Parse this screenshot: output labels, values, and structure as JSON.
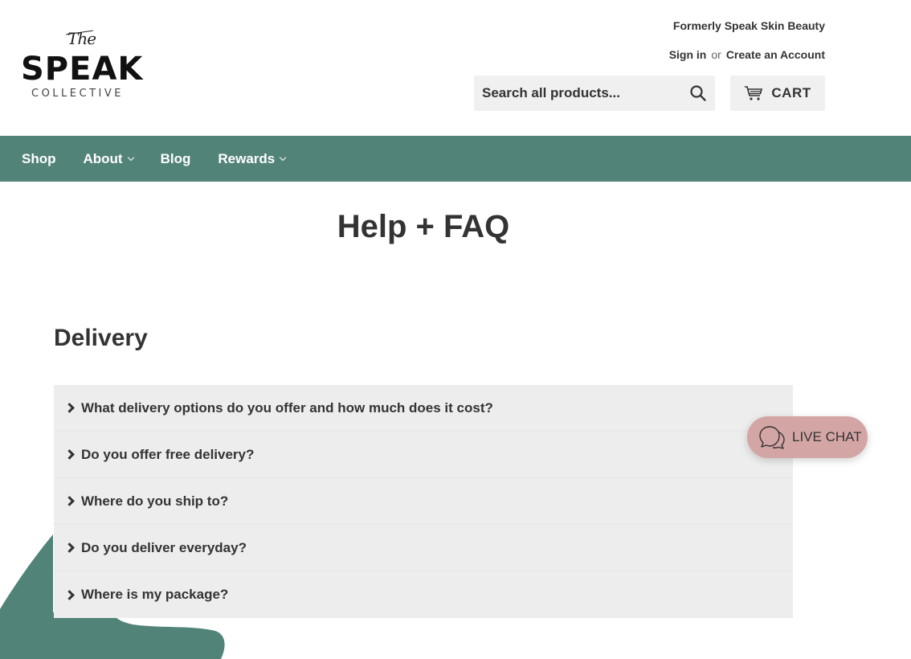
{
  "header": {
    "logo": {
      "the": "The",
      "speak": "SPEAK",
      "collective": "COLLECTIVE"
    },
    "tagline": "Formerly Speak Skin Beauty",
    "sign_in": "Sign in",
    "or": "or",
    "create_account": "Create an Account",
    "search": {
      "placeholder": "Search all products...",
      "icon": "search-icon"
    },
    "cart": {
      "label": "CART",
      "icon": "cart-icon"
    }
  },
  "nav": {
    "items": [
      {
        "label": "Shop",
        "has_dropdown": false
      },
      {
        "label": "About",
        "has_dropdown": true
      },
      {
        "label": "Blog",
        "has_dropdown": false
      },
      {
        "label": "Rewards",
        "has_dropdown": true
      }
    ]
  },
  "page": {
    "title": "Help + FAQ",
    "section_title": "Delivery",
    "faq": [
      {
        "question": "What delivery options do you offer and how much does it cost?"
      },
      {
        "question": "Do you offer free delivery?"
      },
      {
        "question": "Where do you ship to?"
      },
      {
        "question": "Do you deliver everyday?"
      },
      {
        "question": "Where is my package?"
      }
    ]
  },
  "live_chat": {
    "label": "LIVE CHAT",
    "icon": "chat-bubbles-icon"
  },
  "colors": {
    "nav_bg": "#528379",
    "accordion_bg": "#ededed",
    "live_chat_bg": "#d4a5a5",
    "text": "#333333"
  }
}
